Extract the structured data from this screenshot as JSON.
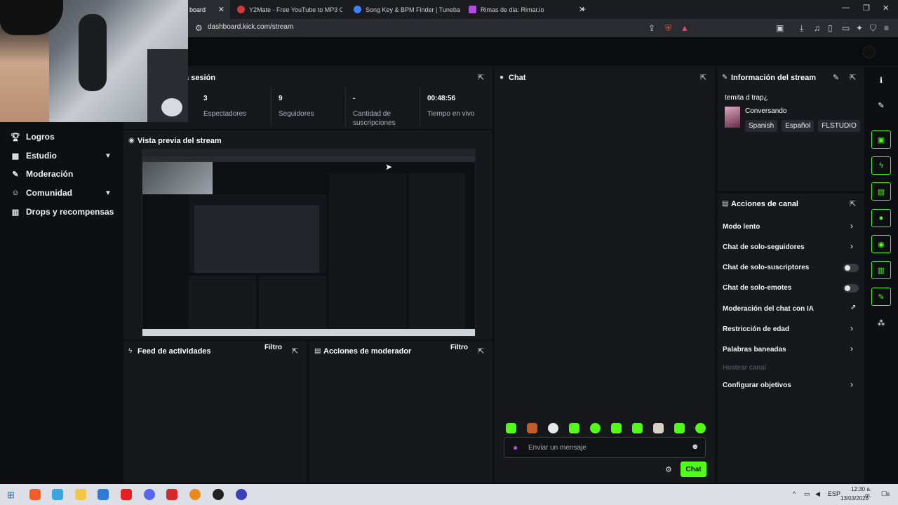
{
  "browser": {
    "tabs": [
      {
        "label": "board",
        "active": true
      },
      {
        "label": "Y2Mate - Free YouTube to MP3 Conv"
      },
      {
        "label": "Song Key & BPM Finder | Tunebat"
      },
      {
        "label": "Rimas de dia: Rimar.io"
      }
    ],
    "new_tab": "+",
    "url": "dashboard.kick.com/stream"
  },
  "sidebar": {
    "items": [
      {
        "label": "Logros",
        "icon": "trophy-icon"
      },
      {
        "label": "Estudio",
        "icon": "grid-icon",
        "expandable": true
      },
      {
        "label": "Moderación",
        "icon": "wrench-icon"
      },
      {
        "label": "Comunidad",
        "icon": "users-icon",
        "expandable": true
      },
      {
        "label": "Drops y recompensas",
        "icon": "chart-icon"
      }
    ]
  },
  "session": {
    "title": "la sesión",
    "stats": [
      {
        "value": "3",
        "label": "Espectadores"
      },
      {
        "value": "9",
        "label": "Seguidores"
      },
      {
        "value": "-",
        "label": "Cantidad de suscripciones"
      },
      {
        "value": "00:48:56",
        "label": "Tiempo en vivo"
      }
    ]
  },
  "preview": {
    "title": "Vista previa del stream"
  },
  "activity": {
    "title": "Feed de actividades",
    "filter": "Filtro"
  },
  "modactions": {
    "title": "Acciones de moderador",
    "filter": "Filtro"
  },
  "chat": {
    "title": "Chat",
    "placeholder": "Enviar un mensaje",
    "send": "Chat"
  },
  "stream_info": {
    "title": "Información del stream",
    "stream_title": "temita d trap¿",
    "category": "Conversando",
    "tags": [
      "Spanish",
      "Español",
      "FLSTUDIO"
    ]
  },
  "channel_actions": {
    "title": "Acciones de canal",
    "items": [
      {
        "label": "Modo lento",
        "type": "chevron"
      },
      {
        "label": "Chat de solo-seguidores",
        "type": "chevron"
      },
      {
        "label": "Chat de solo-suscriptores",
        "type": "toggle",
        "on": false
      },
      {
        "label": "Chat de solo-emotes",
        "type": "toggle",
        "on": false
      },
      {
        "label": "Moderación del chat con IA",
        "type": "external"
      },
      {
        "label": "Restricción de edad",
        "type": "chevron"
      },
      {
        "label": "Palabras baneadas",
        "type": "chevron"
      },
      {
        "label": "Hostear canal",
        "type": "disabled"
      },
      {
        "label": "Configurar objetivos",
        "type": "chevron"
      }
    ]
  },
  "taskbar": {
    "lang": "ESP",
    "time": "12:30 a. m.",
    "date": "13/03/2026",
    "notifications": "8"
  },
  "colors": {
    "accent": "#53fc18",
    "panel": "#17181c",
    "background": "#0e0f12"
  }
}
